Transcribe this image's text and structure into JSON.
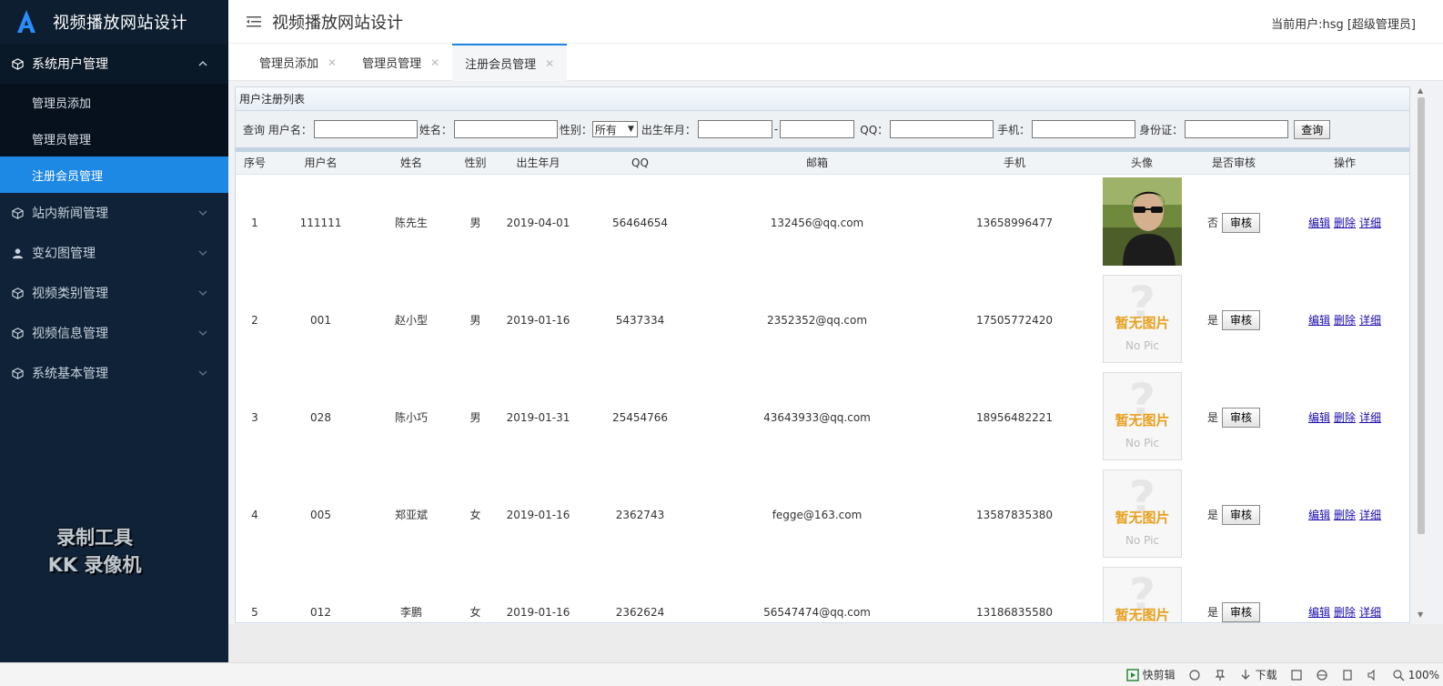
{
  "brand": {
    "title": "视频播放网站设计"
  },
  "sidebar": {
    "groups": [
      {
        "label": "系统用户管理",
        "icon": "cube-icon",
        "open": true,
        "items": [
          {
            "label": "管理员添加"
          },
          {
            "label": "管理员管理"
          },
          {
            "label": "注册会员管理",
            "active": true
          }
        ]
      },
      {
        "label": "站内新闻管理",
        "icon": "cube-icon"
      },
      {
        "label": "变幻图管理",
        "icon": "user-icon"
      },
      {
        "label": "视频类别管理",
        "icon": "cube-icon"
      },
      {
        "label": "视频信息管理",
        "icon": "cube-icon"
      },
      {
        "label": "系统基本管理",
        "icon": "cube-icon"
      }
    ],
    "watermark": [
      "录制工具",
      "KK 录像机"
    ]
  },
  "header": {
    "title": "视频播放网站设计",
    "user": "当前用户:hsg [超级管理员]"
  },
  "tabs": [
    {
      "label": "管理员添加"
    },
    {
      "label": "管理员管理"
    },
    {
      "label": "注册会员管理",
      "active": true
    }
  ],
  "panel": {
    "title": "用户注册列表"
  },
  "search": {
    "query_label": "查询",
    "username_label": "用户名：",
    "name_label": "姓名：",
    "gender_label": "性别：",
    "gender_value": "所有",
    "birth_label": "出生年月：",
    "birth_sep": "-",
    "qq_label": "QQ：",
    "phone_label": "手机：",
    "idcard_label": "身份证：",
    "button": "查询"
  },
  "table": {
    "headers": [
      "序号",
      "用户名",
      "姓名",
      "性别",
      "出生年月",
      "QQ",
      "邮箱",
      "手机",
      "头像",
      "是否审核",
      "操作"
    ],
    "approve_button": "审核",
    "actions": [
      "编辑",
      "删除",
      "详细"
    ],
    "nopic_text": [
      "暂无图片",
      "No Pic"
    ],
    "rows": [
      {
        "no": "1",
        "username": "111111",
        "name": "陈先生",
        "gender": "男",
        "birth": "2019-04-01",
        "qq": "56464654",
        "email": "132456@qq.com",
        "phone": "13658996477",
        "avatar": "photo",
        "approved": "否"
      },
      {
        "no": "2",
        "username": "001",
        "name": "赵小型",
        "gender": "男",
        "birth": "2019-01-16",
        "qq": "5437334",
        "email": "2352352@qq.com",
        "phone": "17505772420",
        "avatar": "nopic",
        "approved": "是"
      },
      {
        "no": "3",
        "username": "028",
        "name": "陈小巧",
        "gender": "男",
        "birth": "2019-01-31",
        "qq": "25454766",
        "email": "43643933@qq.com",
        "phone": "18956482221",
        "avatar": "nopic",
        "approved": "是"
      },
      {
        "no": "4",
        "username": "005",
        "name": "郑亚斌",
        "gender": "女",
        "birth": "2019-01-16",
        "qq": "2362743",
        "email": "fegge@163.com",
        "phone": "13587835380",
        "avatar": "nopic",
        "approved": "是"
      },
      {
        "no": "5",
        "username": "012",
        "name": "李鹏",
        "gender": "女",
        "birth": "2019-01-16",
        "qq": "2362624",
        "email": "56547474@qq.com",
        "phone": "13186835580",
        "avatar": "nopic",
        "approved": "是"
      }
    ]
  },
  "statusbar": {
    "clip": "快剪辑",
    "download": "下载",
    "zoom": "100%"
  }
}
